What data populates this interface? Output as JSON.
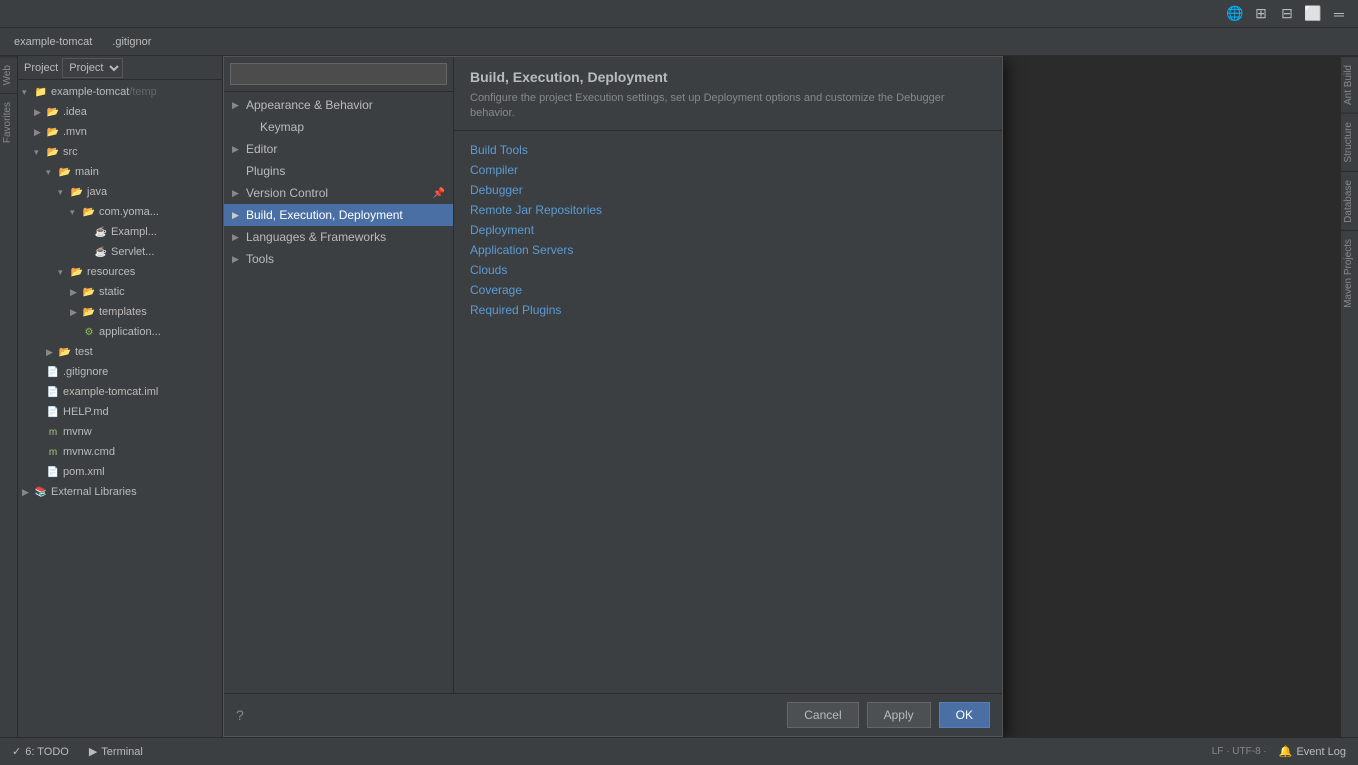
{
  "app": {
    "title": "example-tomcat",
    "tabs": [
      "example-tomcat",
      ".gitignor"
    ]
  },
  "topIcons": [
    "🌐",
    "⊞",
    "⊟",
    "═",
    "✕"
  ],
  "project": {
    "label": "Project",
    "rootName": "example-tomcat",
    "rootPath": "/temp",
    "items": [
      {
        "label": ".idea",
        "indent": 1,
        "type": "folder",
        "expanded": false
      },
      {
        "label": ".mvn",
        "indent": 1,
        "type": "folder",
        "expanded": false
      },
      {
        "label": "src",
        "indent": 1,
        "type": "folder",
        "expanded": true
      },
      {
        "label": "main",
        "indent": 2,
        "type": "folder",
        "expanded": true
      },
      {
        "label": "java",
        "indent": 3,
        "type": "folder",
        "expanded": true
      },
      {
        "label": "com.yoma...",
        "indent": 4,
        "type": "folder",
        "expanded": true
      },
      {
        "label": "Exampl...",
        "indent": 5,
        "type": "java"
      },
      {
        "label": "Servlet...",
        "indent": 5,
        "type": "java"
      },
      {
        "label": "resources",
        "indent": 3,
        "type": "folder",
        "expanded": true
      },
      {
        "label": "static",
        "indent": 4,
        "type": "folder",
        "expanded": false
      },
      {
        "label": "templates",
        "indent": 4,
        "type": "folder",
        "expanded": false
      },
      {
        "label": "application...",
        "indent": 4,
        "type": "file"
      },
      {
        "label": "test",
        "indent": 2,
        "type": "folder",
        "expanded": false
      },
      {
        "label": ".gitignore",
        "indent": 1,
        "type": "gitignore"
      },
      {
        "label": "example-tomcat.iml",
        "indent": 1,
        "type": "iml"
      },
      {
        "label": "HELP.md",
        "indent": 1,
        "type": "md"
      },
      {
        "label": "mvnw",
        "indent": 1,
        "type": "file"
      },
      {
        "label": "mvnw.cmd",
        "indent": 1,
        "type": "file"
      },
      {
        "label": "pom.xml",
        "indent": 1,
        "type": "xml"
      },
      {
        "label": "External Libraries",
        "indent": 0,
        "type": "libs",
        "expanded": false
      }
    ]
  },
  "dialog": {
    "title": "Build, Execution, Deployment",
    "description": "Configure the project Execution settings, set up Deployment options and customize the Debugger behavior.",
    "search": {
      "placeholder": ""
    },
    "navItems": [
      {
        "label": "Appearance & Behavior",
        "hasArrow": true,
        "expanded": true,
        "level": 0
      },
      {
        "label": "Keymap",
        "hasArrow": false,
        "expanded": false,
        "level": 1
      },
      {
        "label": "Editor",
        "hasArrow": true,
        "expanded": false,
        "level": 0
      },
      {
        "label": "Plugins",
        "hasArrow": false,
        "expanded": false,
        "level": 0
      },
      {
        "label": "Version Control",
        "hasArrow": true,
        "expanded": false,
        "level": 0
      },
      {
        "label": "Build, Execution, Deployment",
        "hasArrow": false,
        "expanded": false,
        "level": 0,
        "selected": true
      },
      {
        "label": "Languages & Frameworks",
        "hasArrow": true,
        "expanded": false,
        "level": 0
      },
      {
        "label": "Tools",
        "hasArrow": true,
        "expanded": false,
        "level": 0
      }
    ],
    "contentLinks": [
      "Build Tools",
      "Compiler",
      "Debugger",
      "Remote Jar Repositories",
      "Deployment",
      "Application Servers",
      "Clouds",
      "Coverage",
      "Required Plugins"
    ],
    "buttons": {
      "cancel": "Cancel",
      "apply": "Apply",
      "ok": "OK"
    }
  },
  "bottomBar": {
    "tabs": [
      "6: TODO",
      "Terminal"
    ],
    "rightItems": [
      "Event Log"
    ]
  },
  "rightPanels": [
    "Ant Build",
    "Structure",
    "Database",
    "Maven Projects"
  ],
  "leftEdgeTabs": [
    "Web",
    "Favorites"
  ]
}
